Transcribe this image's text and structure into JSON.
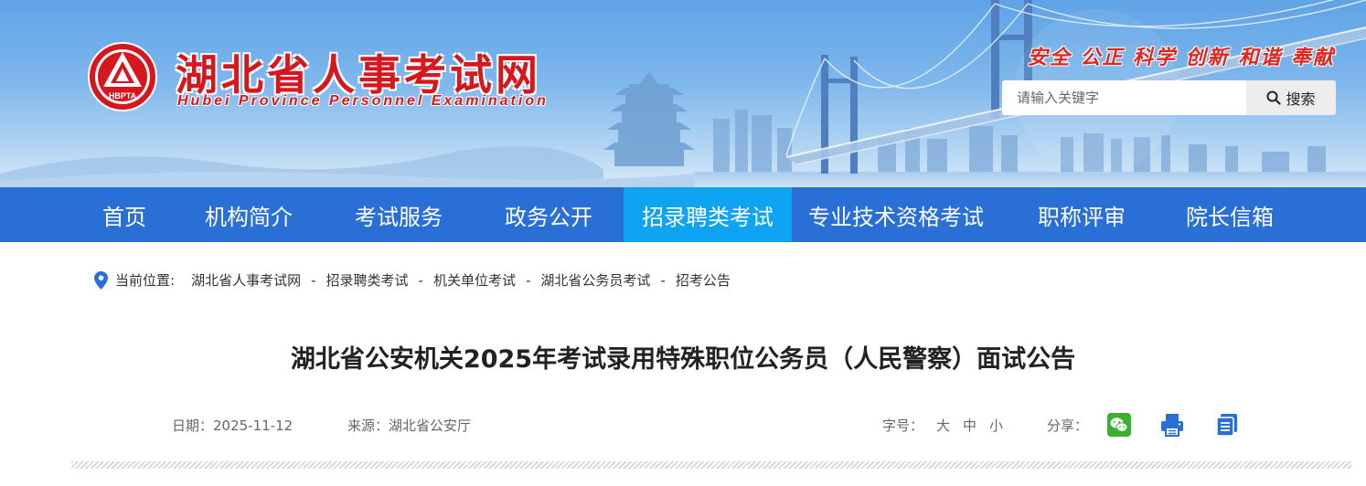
{
  "header": {
    "site_title": "湖北省人事考试网",
    "site_title_en": "Hubei Province Personnel Examination",
    "emblem_text": "HBPTA",
    "slogan": "安全 公正 科学 创新 和谐 奉献",
    "brand_red": "#d6181e"
  },
  "search": {
    "placeholder": "请输入关键字",
    "value": "",
    "button_label": "搜索"
  },
  "nav": {
    "items": [
      {
        "label": "首页"
      },
      {
        "label": "机构简介"
      },
      {
        "label": "考试服务"
      },
      {
        "label": "政务公开"
      },
      {
        "label": "招录聘类考试",
        "active": true
      },
      {
        "label": "专业技术资格考试"
      },
      {
        "label": "职称评审"
      },
      {
        "label": "院长信箱"
      }
    ],
    "bg_color": "#2a6fd6",
    "active_color": "#0fa3f4"
  },
  "breadcrumb": {
    "label": "当前位置:",
    "items": [
      "湖北省人事考试网",
      "招录聘类考试",
      "机关单位考试",
      "湖北省公务员考试",
      "招考公告"
    ],
    "separator": "-"
  },
  "article": {
    "title": "湖北省公安机关2025年考试录用特殊职位公务员（人民警察）面试公告",
    "date_label": "日期：2025-11-12",
    "source_label": "来源：湖北省公安厅",
    "font_size_label": "字号：",
    "font_sizes": [
      "大",
      "中",
      "小"
    ],
    "share_label": "分享："
  },
  "icons": {
    "share_wechat": "wechat-icon",
    "print": "print-icon",
    "copy": "document-icon",
    "location": "location-pin-icon",
    "search": "search-icon"
  }
}
